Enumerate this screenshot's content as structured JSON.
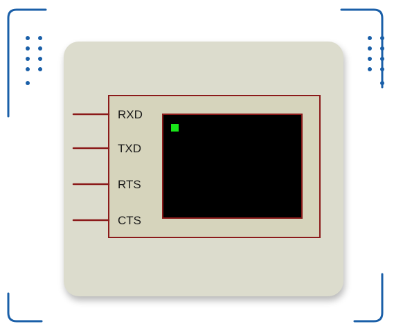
{
  "component": {
    "pins": [
      {
        "label": "RXD"
      },
      {
        "label": "TXD"
      },
      {
        "label": "RTS"
      },
      {
        "label": "CTS"
      }
    ]
  },
  "colors": {
    "frame_accent": "#1a5fa8",
    "panel_background": "#dcdccd",
    "component_border": "#8b1a1a",
    "pin_wire": "#8b1a1a",
    "screen_background": "#000000",
    "cursor_indicator": "#19e619"
  },
  "icons": {
    "frame_corners": "corner-bracket-icon",
    "dot_grids": "dot-grid-icon"
  }
}
